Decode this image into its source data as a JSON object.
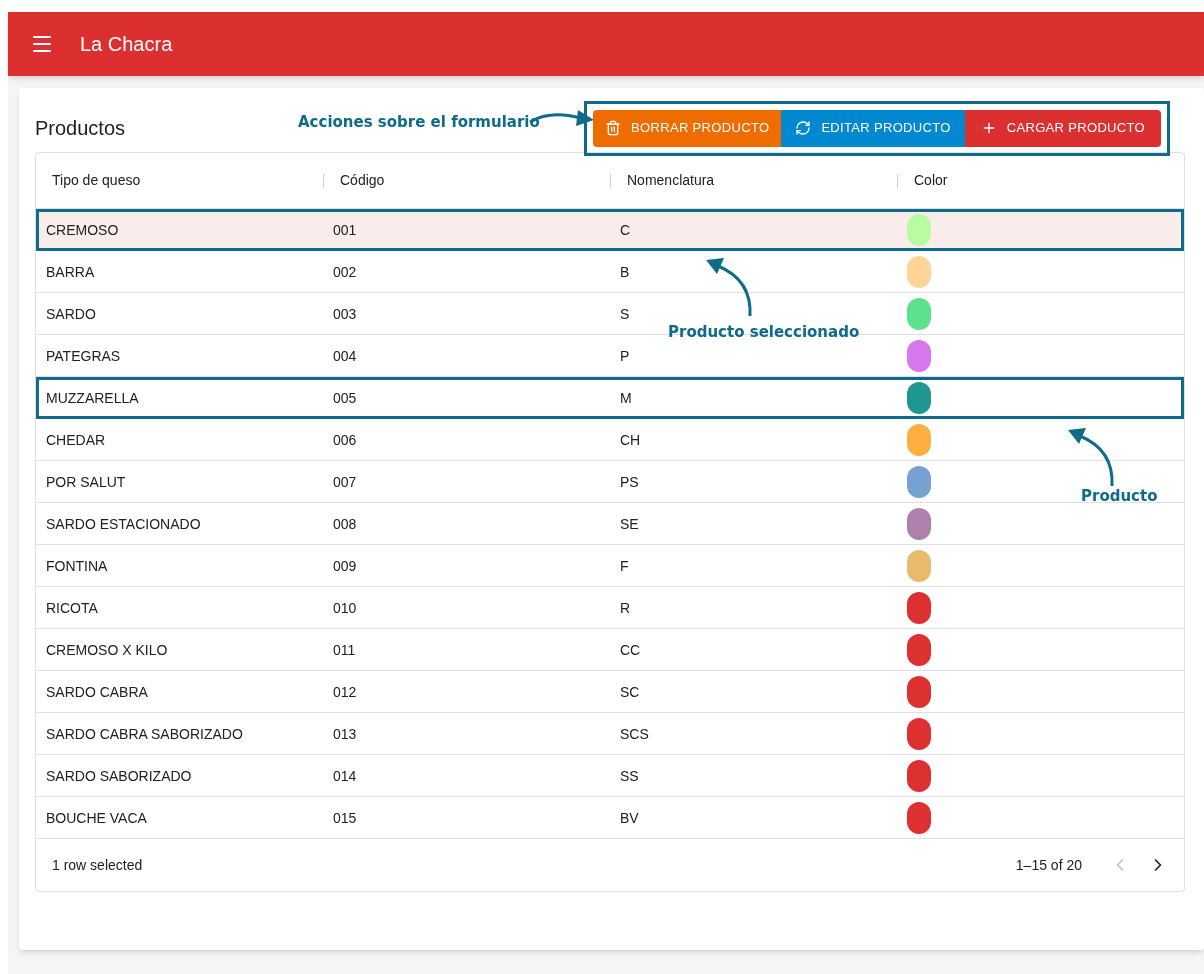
{
  "app_bar": {
    "title": "La Chacra"
  },
  "card": {
    "title": "Productos"
  },
  "actions": {
    "outlined": true,
    "buttons": [
      {
        "label": "BORRAR PRODUCTO",
        "kind": "delete"
      },
      {
        "label": "EDITAR PRODUCTO",
        "kind": "edit"
      },
      {
        "label": "CARGAR PRODUCTO",
        "kind": "add"
      }
    ]
  },
  "table": {
    "columns": [
      "Tipo de queso",
      "Código",
      "Nomenclatura",
      "Color"
    ],
    "rows": [
      {
        "cells": [
          "CREMOSO",
          "001",
          "C"
        ],
        "color": "#b9fba0",
        "selected": true,
        "outlined": true
      },
      {
        "cells": [
          "BARRA",
          "002",
          "B"
        ],
        "color": "#fed596",
        "selected": false,
        "outlined": false
      },
      {
        "cells": [
          "SARDO",
          "003",
          "S"
        ],
        "color": "#5ce28d",
        "selected": false,
        "outlined": false
      },
      {
        "cells": [
          "PATEGRAS",
          "004",
          "P"
        ],
        "color": "#d878ee",
        "selected": false,
        "outlined": false
      },
      {
        "cells": [
          "MUZZARELLA",
          "005",
          "M"
        ],
        "color": "#1f9690",
        "selected": false,
        "outlined": true
      },
      {
        "cells": [
          "CHEDAR",
          "006",
          "CH"
        ],
        "color": "#fdaf40",
        "selected": false,
        "outlined": false
      },
      {
        "cells": [
          "POR SALUT",
          "007",
          "PS"
        ],
        "color": "#76a1d2",
        "selected": false,
        "outlined": false
      },
      {
        "cells": [
          "SARDO ESTACIONADO",
          "008",
          "SE"
        ],
        "color": "#ae80ab",
        "selected": false,
        "outlined": false
      },
      {
        "cells": [
          "FONTINA",
          "009",
          "F"
        ],
        "color": "#e9ba6e",
        "selected": false,
        "outlined": false
      },
      {
        "cells": [
          "RICOTA",
          "010",
          "R"
        ],
        "color": "#dd3030",
        "selected": false,
        "outlined": false
      },
      {
        "cells": [
          "CREMOSO X KILO",
          "011",
          "CC"
        ],
        "color": "#dd3030",
        "selected": false,
        "outlined": false
      },
      {
        "cells": [
          "SARDO CABRA",
          "012",
          "SC"
        ],
        "color": "#dd3030",
        "selected": false,
        "outlined": false
      },
      {
        "cells": [
          "SARDO CABRA SABORIZADO",
          "013",
          "SCS"
        ],
        "color": "#dd3030",
        "selected": false,
        "outlined": false
      },
      {
        "cells": [
          "SARDO SABORIZADO",
          "014",
          "SS"
        ],
        "color": "#dd3030",
        "selected": false,
        "outlined": false
      },
      {
        "cells": [
          "BOUCHE VACA",
          "015",
          "BV"
        ],
        "color": "#dd3030",
        "selected": false,
        "outlined": false
      }
    ],
    "footer": {
      "selection": "1 row selected",
      "range": "1–15 of 20",
      "prev_disabled": true,
      "next_disabled": false
    }
  },
  "annotations": [
    {
      "text": "Acciones sobre el formulario",
      "kind": "right"
    },
    {
      "text": "Producto seleccionado",
      "kind": "up"
    },
    {
      "text": "Producto",
      "kind": "up"
    }
  ]
}
